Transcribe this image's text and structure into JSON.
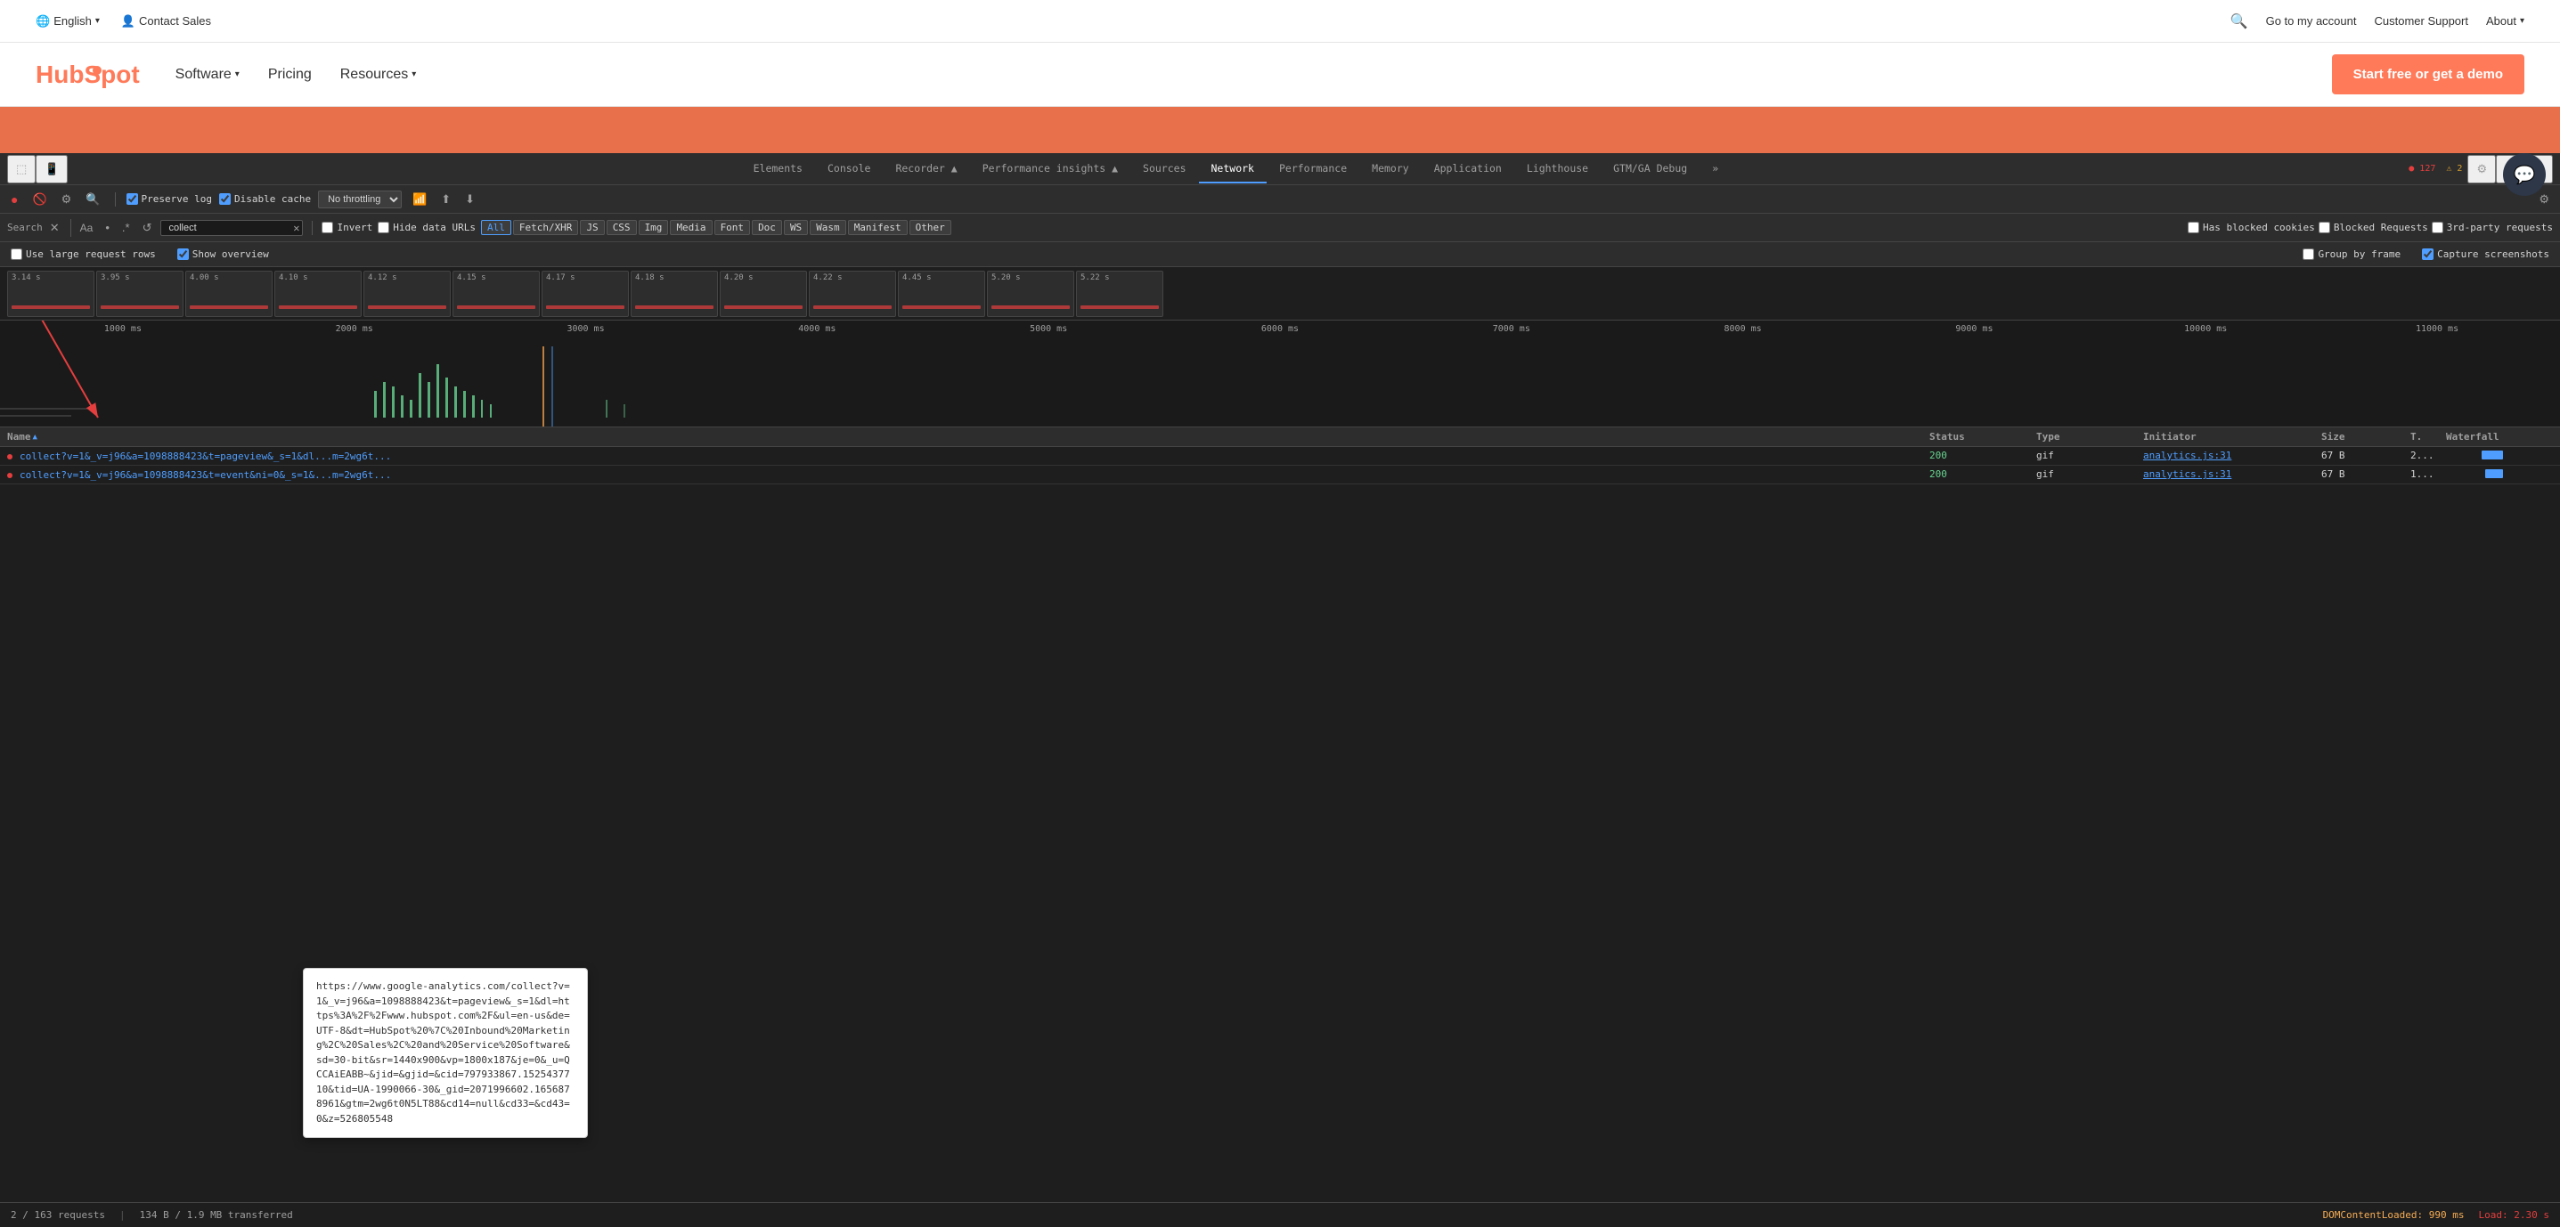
{
  "topnav": {
    "language": "English",
    "contact_sales": "Contact Sales",
    "go_to_account": "Go to my account",
    "customer_support": "Customer Support",
    "about": "About"
  },
  "mainnav": {
    "logo": "HubSpot",
    "software": "Software",
    "pricing": "Pricing",
    "resources": "Resources",
    "cta": "Start free or get a demo"
  },
  "devtools": {
    "tabs": [
      "Elements",
      "Console",
      "Recorder ▲",
      "Performance insights ▲",
      "Sources",
      "Network",
      "Performance",
      "Memory",
      "Application",
      "Lighthouse",
      "GTM/GA Debug",
      "»"
    ],
    "active_tab": "Network",
    "badge_red": "127",
    "badge_yellow": "2",
    "toolbar": {
      "preserve_log": "Preserve log",
      "disable_cache": "Disable cache",
      "throttle": "No throttling"
    },
    "search": {
      "placeholder": "Search",
      "value": "collect",
      "label": "Search"
    },
    "filters": {
      "invert": "Invert",
      "hide_data_urls": "Hide data URLs",
      "all": "All",
      "fetch_xhr": "Fetch/XHR",
      "js": "JS",
      "css": "CSS",
      "img": "Img",
      "media": "Media",
      "font": "Font",
      "doc": "Doc",
      "ws": "WS",
      "wasm": "Wasm",
      "manifest": "Manifest",
      "other": "Other",
      "has_blocked_cookies": "Has blocked cookies",
      "blocked_requests": "Blocked Requests",
      "third_party": "3rd-party requests"
    },
    "options": {
      "use_large_rows": "Use large request rows",
      "show_overview": "Show overview",
      "group_by_frame": "Group by frame",
      "capture_screenshots": "Capture screenshots"
    },
    "timeline": {
      "labels": [
        "3.14 s",
        "3.95 s",
        "4.00 s",
        "4.10 s",
        "4.12 s",
        "4.15 s",
        "4.17 s",
        "4.18 s",
        "4.20 s",
        "4.22 s",
        "4.45 s",
        "5.20 s",
        "5.22 s"
      ]
    },
    "chart": {
      "labels": [
        "1000 ms",
        "2000 ms",
        "3000 ms",
        "4000 ms",
        "5000 ms",
        "6000 ms",
        "7000 ms",
        "8000 ms",
        "9000 ms",
        "10000 ms",
        "11000 ms"
      ]
    },
    "table": {
      "headers": [
        "Name",
        "Status",
        "Type",
        "Initiator",
        "Size",
        "T.",
        "Waterfall"
      ],
      "rows": [
        {
          "name": "collect?v=1&_v=j96&a=1098888423&t=pageview&_s=1&dl...m=2wg6t...",
          "status": "200",
          "type": "gif",
          "initiator": "analytics.js:31",
          "size": "67 B",
          "time": "2...",
          "waterfall": "blue"
        },
        {
          "name": "collect?v=1&_v=j96&a=1098888423&t=event&ni=0&_s=1&...m=2wg6t...",
          "status": "200",
          "type": "gif",
          "initiator": "analytics.js:31",
          "size": "67 B",
          "time": "1...",
          "waterfall": "blue"
        }
      ]
    },
    "statusbar": {
      "requests": "2 / 163 requests",
      "transfer": "134 B / 1.9 MB transferred",
      "dom_content": "DOMContentLoaded: 990 ms",
      "load": "Load: 2.30 s"
    },
    "tooltip": {
      "url": "https://www.google-analytics.com/collect?v=1&_v=j96&a=1098888423&t=pageview&_s=1&dl=https%3A%2F%2Fwww.hubspot.com%2F&ul=en-us&de=UTF-8&dt=HubSpot%20%7C%20Inbound%20Marketing%2C%20Sales%2C%20and%20Service%20Software&sd=30-bit&sr=1440x900&vp=1800x187&je=0&_u=QCCAiEABB~&jid=&gjid=&cid=797933867.1525437710&tid=UA-1990066-30&_gid=2071996602.1656878961&gtm=2wg6t0N5LT88&cd14=null&cd33=&cd43=0&z=526805548"
    }
  }
}
